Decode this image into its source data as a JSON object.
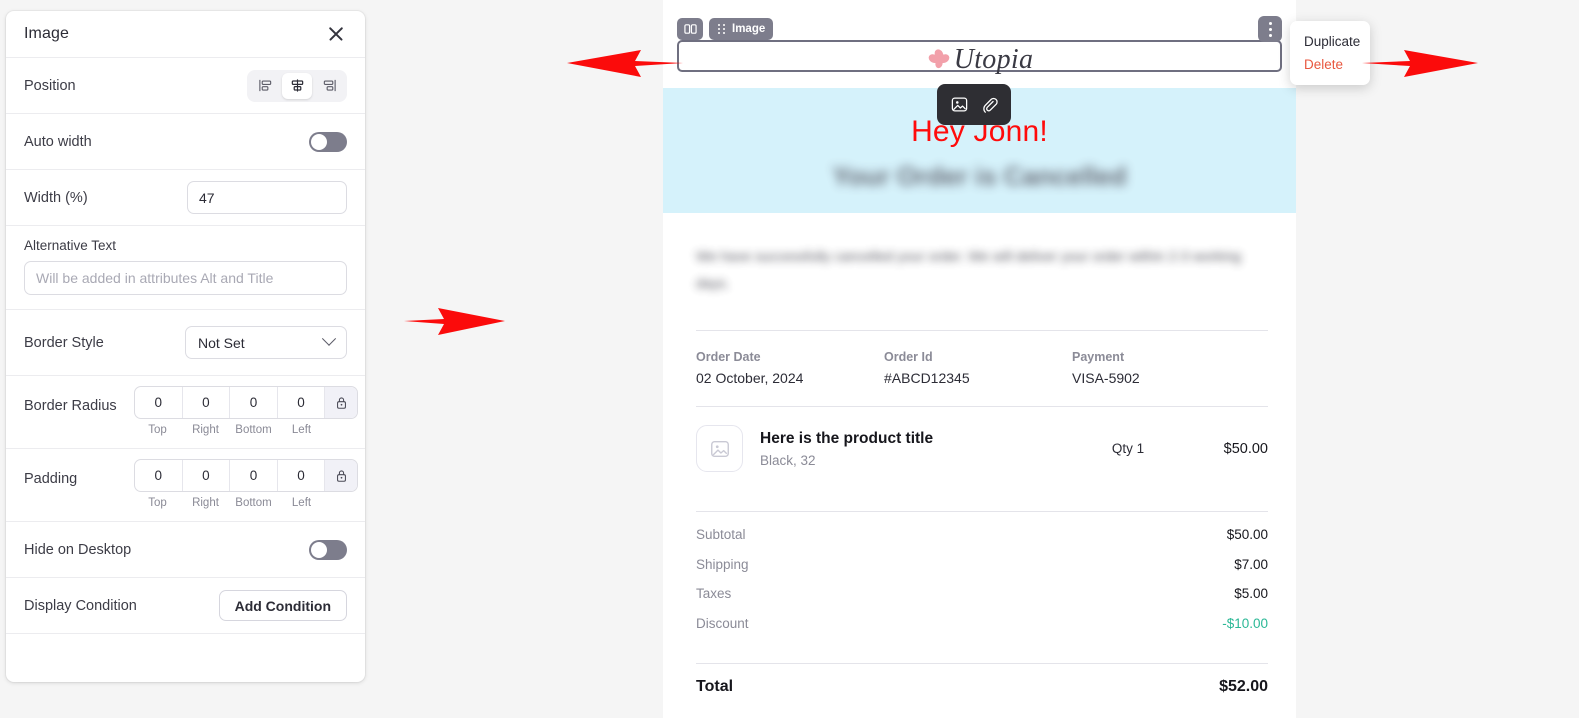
{
  "panel": {
    "title": "Image",
    "close_icon": "close-icon",
    "rows": {
      "position": {
        "label": "Position",
        "options": [
          "align-left",
          "align-center",
          "align-right"
        ],
        "selected": "align-center"
      },
      "auto_width": {
        "label": "Auto width",
        "value": "off"
      },
      "width": {
        "label": "Width (%)",
        "value": "47"
      },
      "alternative_text": {
        "label": "Alternative Text",
        "value": "",
        "placeholder": "Will be added in attributes Alt and Title"
      },
      "border_style": {
        "label": "Border Style",
        "value": "Not Set"
      },
      "border_radius": {
        "label": "Border Radius",
        "values": [
          "0",
          "0",
          "0",
          "0"
        ],
        "captions": [
          "Top",
          "Right",
          "Bottom",
          "Left"
        ],
        "lock_icon": "lock-icon"
      },
      "padding": {
        "label": "Padding",
        "values": [
          "0",
          "0",
          "0",
          "0"
        ],
        "captions": [
          "Top",
          "Right",
          "Bottom",
          "Left"
        ],
        "lock_icon": "lock-icon"
      },
      "hide_on_desktop": {
        "label": "Hide on Desktop",
        "value": "off"
      },
      "display_condition": {
        "label": "Display Condition",
        "button": "Add Condition"
      }
    }
  },
  "editor": {
    "block_chip": {
      "columns_icon": "two-columns-icon",
      "drag_icon": "drag-handle-icon",
      "label": "Image"
    },
    "kebab_icon": "kebab-menu-icon",
    "float_toolbar": {
      "image_icon": "image-icon",
      "link_icon": "link-icon"
    },
    "context_menu": {
      "duplicate": "Duplicate",
      "delete": "Delete"
    }
  },
  "email": {
    "logo": {
      "mark_icon": "flower-icon",
      "text": "Utopia"
    },
    "hero": {
      "greeting": "Hey Jonn!",
      "subtitle": "Your Order is Cancelled"
    },
    "intro": "We have successfully cancelled your order. We will deliver your order within 2-3 working days.",
    "intro_highlight": "cancelled",
    "meta": [
      {
        "label": "Order Date",
        "value": "02 October, 2024"
      },
      {
        "label": "Order Id",
        "value": "#ABCD12345"
      },
      {
        "label": "Payment",
        "value": "VISA-5902"
      }
    ],
    "product": {
      "thumb_icon": "image-placeholder-icon",
      "title": "Here is the product title",
      "variant": "Black, 32",
      "qty": "Qty 1",
      "price": "$50.00"
    },
    "totals": [
      {
        "label": "Subtotal",
        "value": "$50.00",
        "style": "normal"
      },
      {
        "label": "Shipping",
        "value": "$7.00",
        "style": "normal"
      },
      {
        "label": "Taxes",
        "value": "$5.00",
        "style": "normal"
      },
      {
        "label": "Discount",
        "value": "-$10.00",
        "style": "discount"
      }
    ],
    "grand_total": {
      "label": "Total",
      "value": "$52.00"
    }
  },
  "annotations": {
    "arrow_logo": "arrow-pointing-right-at-logo-field",
    "arrow_delete": "arrow-pointing-left-at-delete",
    "arrow_panel": "arrow-pointing-left-at-settings-panel"
  },
  "colors": {
    "accent_red": "#ff0b0b",
    "hero_bg": "#d5f2fb",
    "discount_green": "#2bb896",
    "delete_red": "#e8573f",
    "chip_grey": "#7d7d8c"
  }
}
